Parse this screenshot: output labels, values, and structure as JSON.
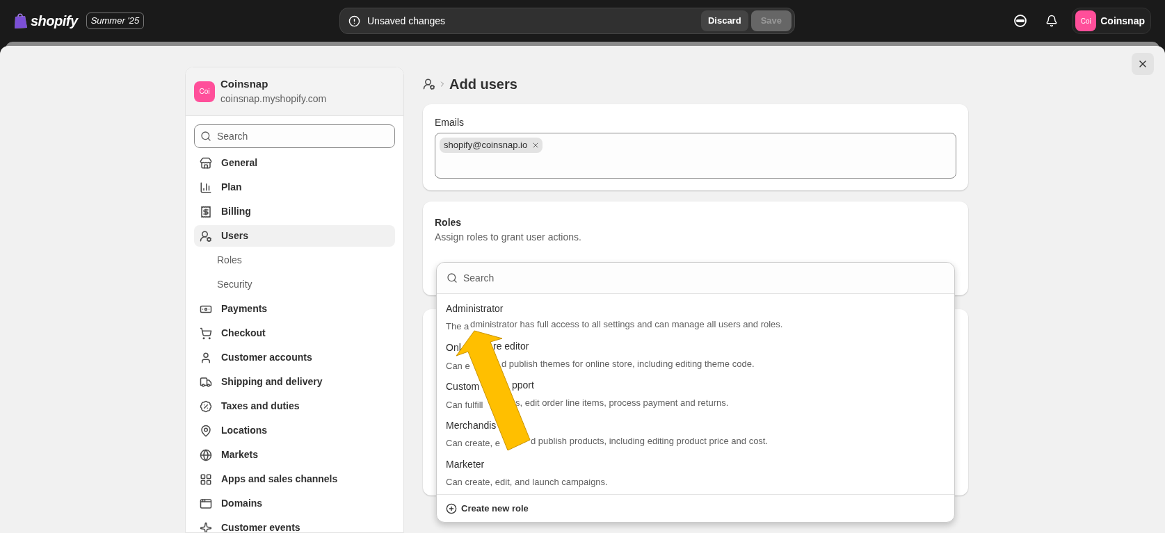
{
  "topbar": {
    "logo": "shopify",
    "edition": "Summer '25",
    "notice": "Unsaved changes",
    "discard": "Discard",
    "save": {
      "label": "Save",
      "disabled": true
    },
    "store_badge": "Coi",
    "store_name": "Coinsnap"
  },
  "sidebar": {
    "store": {
      "badge": "Coi",
      "name": "Coinsnap",
      "domain": "coinsnap.myshopify.com"
    },
    "search": {
      "placeholder": "Search"
    },
    "items": [
      {
        "label": "General",
        "selected": false
      },
      {
        "label": "Plan",
        "selected": false
      },
      {
        "label": "Billing",
        "selected": false
      },
      {
        "label": "Users",
        "selected": true,
        "children": [
          {
            "label": "Roles",
            "selected": false
          },
          {
            "label": "Security",
            "selected": false
          }
        ]
      },
      {
        "label": "Payments",
        "selected": false
      },
      {
        "label": "Checkout",
        "selected": false
      },
      {
        "label": "Customer accounts",
        "selected": false
      },
      {
        "label": "Shipping and delivery",
        "selected": false
      },
      {
        "label": "Taxes and duties",
        "selected": false
      },
      {
        "label": "Locations",
        "selected": false
      },
      {
        "label": "Markets",
        "selected": false
      },
      {
        "label": "Apps and sales channels",
        "selected": false
      },
      {
        "label": "Domains",
        "selected": false
      },
      {
        "label": "Customer events",
        "selected": false
      }
    ]
  },
  "page": {
    "title": "Add users",
    "emails": {
      "label": "Emails",
      "tokens": [
        "shopify@coinsnap.io"
      ]
    },
    "roles": {
      "title": "Roles",
      "description": "Assign roles to grant user actions.",
      "dropdown": {
        "search": {
          "placeholder": "Search"
        },
        "options": [
          {
            "name": [
              "Administrator"
            ],
            "description": [
              "The a",
              "dministrator has full access to all settings and can manage all users and roles."
            ]
          },
          {
            "name": [
              "Onl",
              "re editor"
            ],
            "description": [
              "Can e",
              "d publish themes for online store, including editing theme code."
            ]
          },
          {
            "name": [
              "Custom",
              "pport"
            ],
            "description": [
              "Can fulfill",
              "s, edit order line items, process payment and returns."
            ]
          },
          {
            "name": [
              "Merchandis"
            ],
            "description": [
              "Can create, e",
              "d publish products, including editing product price and cost."
            ]
          },
          {
            "name": [
              "Marketer"
            ],
            "description": [
              "Can create, edit, and launch campaigns."
            ]
          }
        ],
        "create": "Create new role"
      }
    }
  }
}
